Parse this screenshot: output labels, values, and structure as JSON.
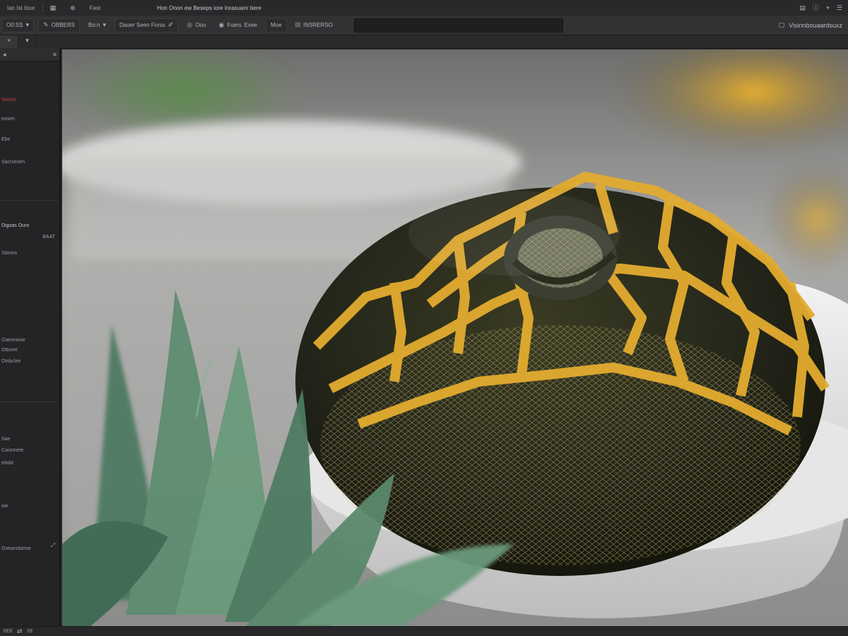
{
  "menubar": {
    "items": [
      "Ian Ist Itsor",
      "Fast"
    ],
    "doc_title": "Hon Onon ew Beseps iore Inrasuanr bere"
  },
  "options": {
    "preset": "O0:SS",
    "mode": "OBBERS",
    "layer_label": "Bo:n",
    "style_label": "Daoer Seen Forss",
    "view_a": "Ooo",
    "view_b": "Fuers",
    "view_c": "Exee",
    "unit_label": "Moe",
    "spacing_label": "INSRERSO",
    "search_placeholder": "",
    "right_label": "Visinnbouaardsuxz"
  },
  "left_panel": {
    "header": "",
    "section_title": "Digoas Ouro",
    "section_value": "BAAT",
    "rows": [
      "Sovvrs",
      "eosen",
      "Ebe",
      "Sacrsesen",
      "Sttrons",
      "Oaeonwoe",
      "Ottsore",
      "Otsbcleir",
      "Sae",
      "Caisnnete",
      "eitobt",
      "eie",
      "Osearsdanse"
    ]
  },
  "status": {
    "left": "SEE",
    "zoom": "SE"
  },
  "colors": {
    "chrome_dark": "#242426",
    "chrome_mid": "#323234",
    "accent_red": "#d0413f",
    "snake_yellow": "#e8b43a",
    "snake_dark": "#1f2117"
  }
}
